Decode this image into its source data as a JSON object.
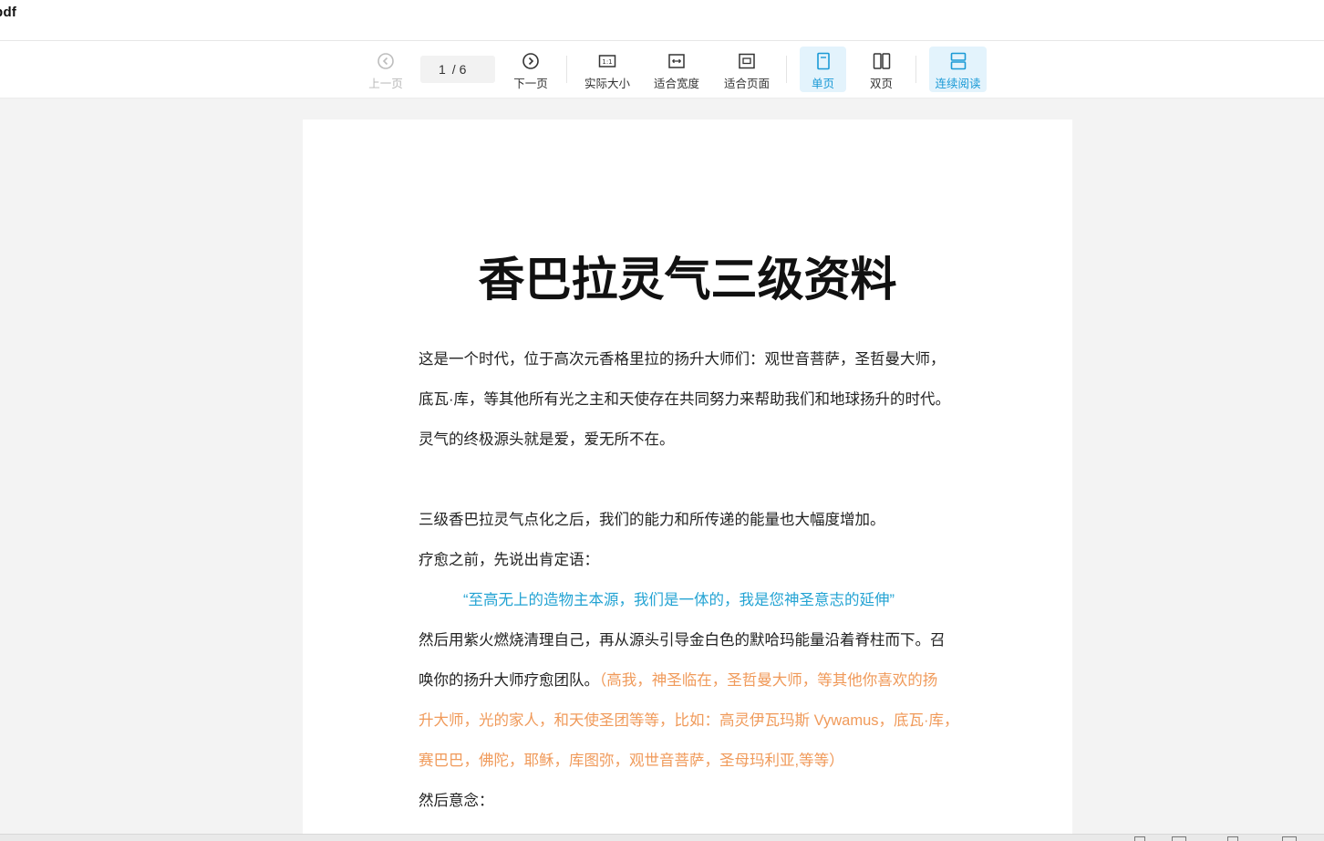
{
  "titlebar": {
    "filename": "pdf"
  },
  "toolbar": {
    "prev_label": "上一页",
    "page_current": "1",
    "page_total": "/ 6",
    "next_label": "下一页",
    "actual_size_label": "实际大小",
    "fit_width_label": "适合宽度",
    "fit_page_label": "适合页面",
    "single_page_label": "单页",
    "double_page_label": "双页",
    "continuous_label": "连续阅读",
    "accent_color": "#1a9ad6"
  },
  "document": {
    "title": "香巴拉灵气三级资料",
    "lines": [
      "这是一个时代，位于高次元香格里拉的扬升大师们：观世音菩萨，圣哲曼大师，",
      "底瓦·库，等其他所有光之主和天使存在共同努力来帮助我们和地球扬升的时代。",
      "灵气的终极源头就是爱，爱无所不在。",
      "三级香巴拉灵气点化之后，我们的能力和所传递的能量也大幅度增加。",
      "疗愈之前，先说出肯定语：",
      "“至高无上的造物主本源，我们是一体的，我是您神圣意志的延伸”",
      "然后用紫火燃烧清理自己，再从源头引导金白色的默哈玛能量沿着脊柱而下。召",
      "唤你的扬升大师疗愈团队。",
      "（高我，神圣临在，圣哲曼大师，等其他你喜欢的扬",
      "升大师，光的家人，和天使圣团等等，比如：高灵伊瓦玛斯 Vywamus，底瓦·库，",
      "赛巴巴，佛陀，耶稣，库图弥，观世音菩萨，圣母玛利亚,等等）",
      "然后意念："
    ],
    "highlight_blue": "#23a3d3",
    "highlight_orange": "#f09a5a"
  }
}
